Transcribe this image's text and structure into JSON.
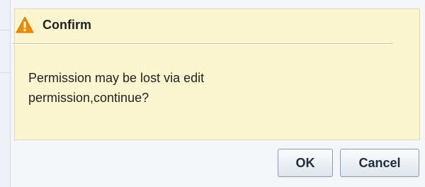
{
  "dialog": {
    "title": "Confirm",
    "icon": "warning-icon",
    "message_lines": [
      "Permission may be lost via edit",
      "permission,continue?"
    ],
    "buttons": {
      "ok_label": "OK",
      "cancel_label": "Cancel"
    },
    "colors": {
      "panel_background": "#fbf6cf",
      "warning_icon": "#f08a00"
    }
  }
}
